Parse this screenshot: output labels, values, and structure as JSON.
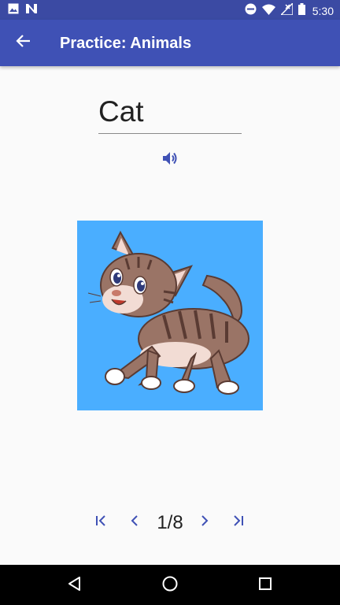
{
  "status_bar": {
    "time": "5:30",
    "left_icons": [
      "image-icon",
      "n-app-icon"
    ],
    "right_icons": [
      "do-not-disturb-icon",
      "wifi-icon",
      "no-signal-icon",
      "battery-icon"
    ]
  },
  "app_bar": {
    "title": "Practice: Animals",
    "back_icon": "arrow-back-icon",
    "color": "#3f51b5"
  },
  "word": {
    "value": "Cat",
    "placeholder": ""
  },
  "audio": {
    "icon": "speaker-icon",
    "color": "#3f51b5"
  },
  "picture": {
    "subject": "cat",
    "background": "#4aaeff"
  },
  "pager": {
    "counter": "1/8",
    "icons": [
      "first-page-icon",
      "previous-icon",
      "next-icon",
      "last-page-icon"
    ]
  },
  "nav_bar": {
    "icons": [
      "back-triangle-icon",
      "home-circle-icon",
      "recents-square-icon"
    ]
  }
}
